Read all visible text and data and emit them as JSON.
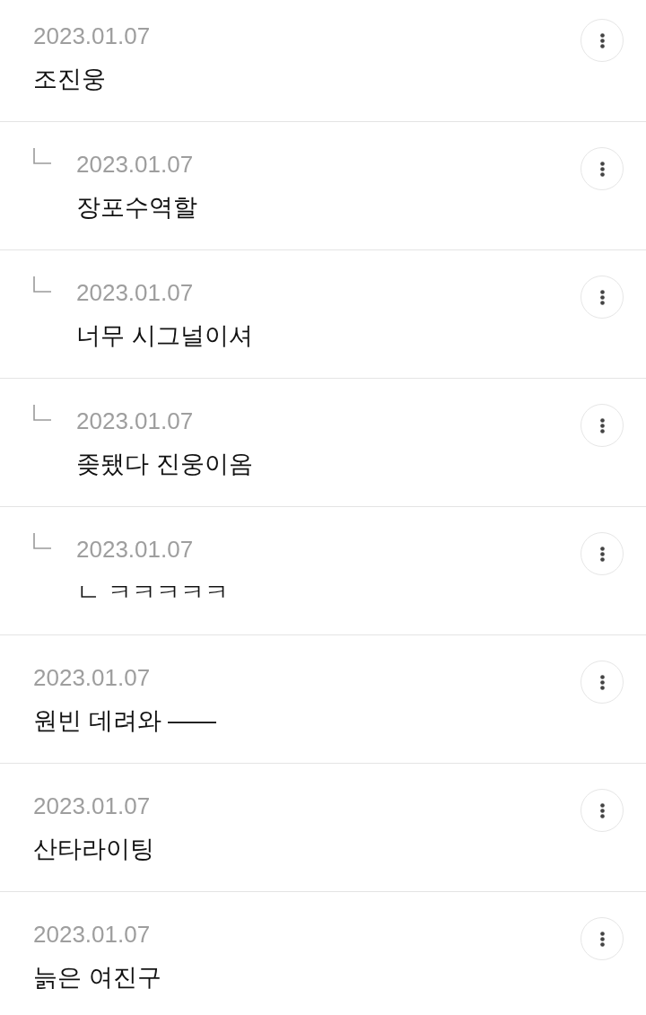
{
  "comments": [
    {
      "date": "2023.01.07",
      "text": "조진웅",
      "children": [
        {
          "date": "2023.01.07",
          "text": "장포수역할"
        },
        {
          "date": "2023.01.07",
          "text": "너무 시그널이셔"
        },
        {
          "date": "2023.01.07",
          "text": "좆됐다 진웅이옴"
        },
        {
          "date": "2023.01.07",
          "text": "ㄴ ㅋㅋㅋㅋㅋ"
        }
      ]
    },
    {
      "date": "2023.01.07",
      "text": "원빈 데려와 ——"
    },
    {
      "date": "2023.01.07",
      "text": "산타라이팅"
    },
    {
      "date": "2023.01.07",
      "text": "늙은 여진구"
    }
  ]
}
